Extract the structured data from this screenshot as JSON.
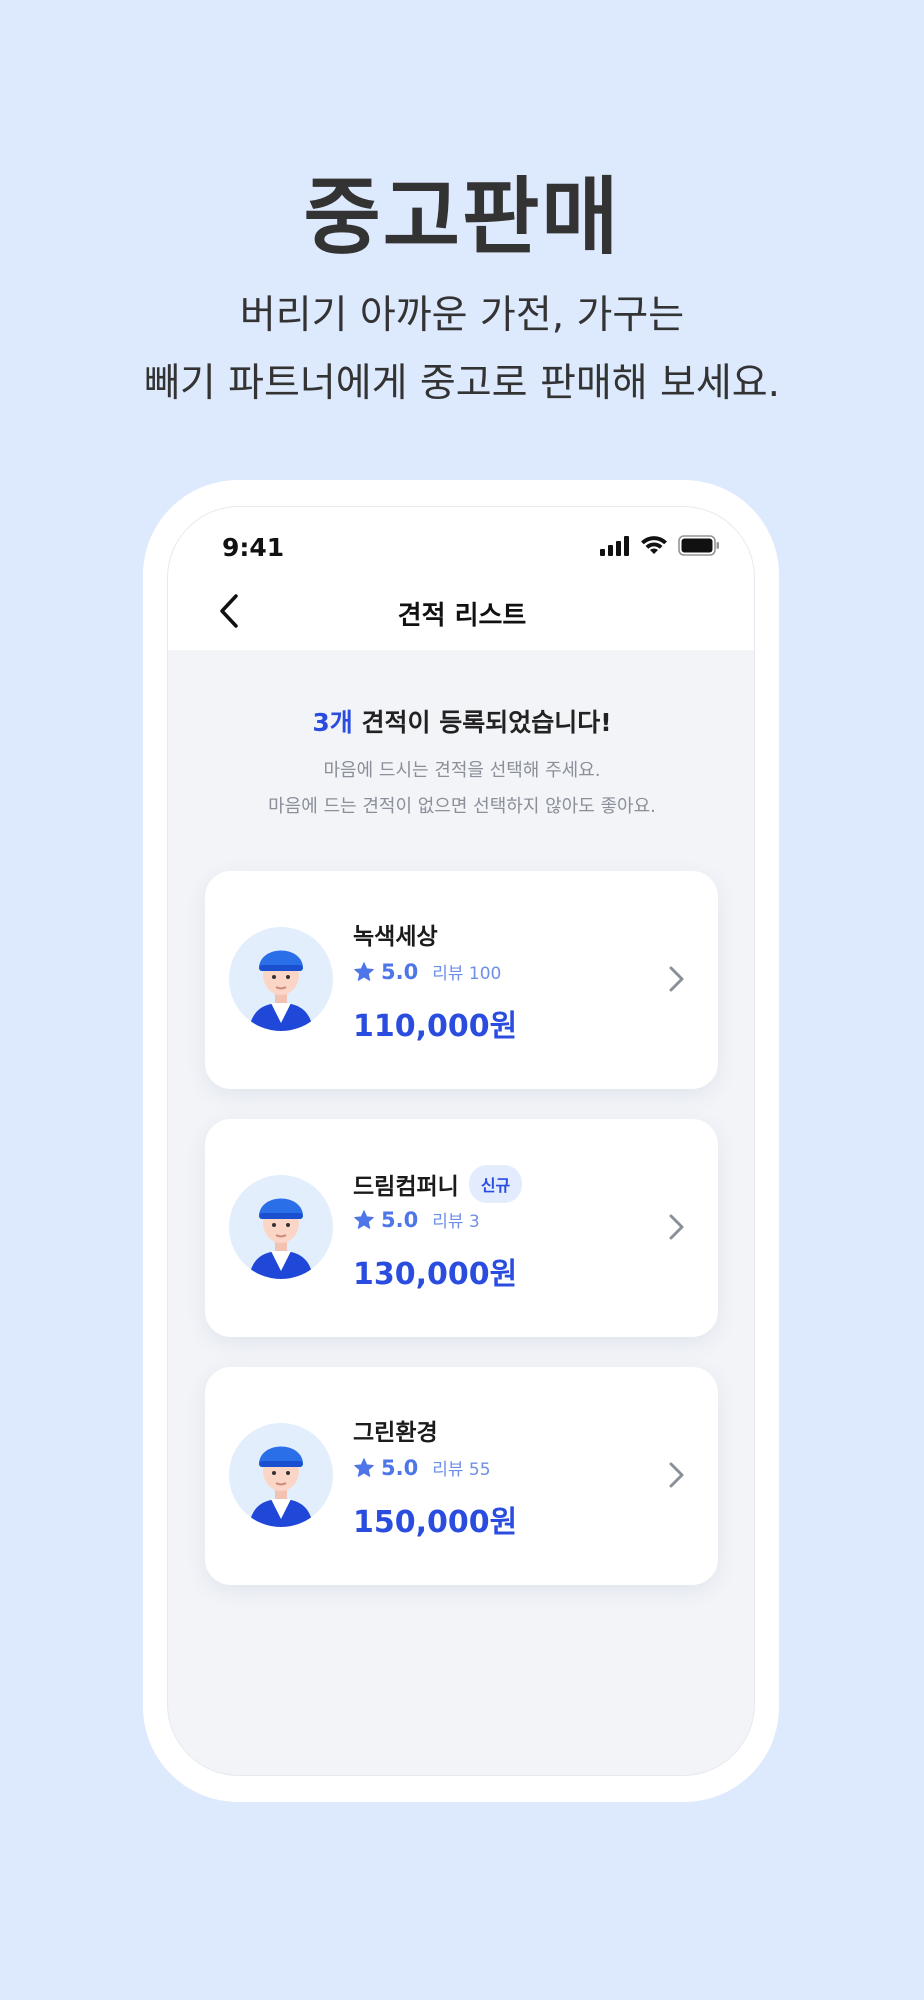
{
  "hero": {
    "title": "중고판매",
    "subtitle_line1": "버리기 아까운 가전, 가구는",
    "subtitle_line2": "빼기 파트너에게 중고로 판매해 보세요."
  },
  "status_bar": {
    "time": "9:41",
    "icons": [
      "signal-icon",
      "wifi-icon",
      "battery-icon"
    ]
  },
  "nav": {
    "title": "견적 리스트",
    "back_icon": "chevron-left-icon"
  },
  "summary": {
    "count": "3개",
    "headline_rest": " 견적이 등록되었습니다!",
    "desc_line1": "마음에 드시는 견적을 선택해 주세요.",
    "desc_line2": "마음에 드는 견적이 없으면 선택하지 않아도 좋아요."
  },
  "quotes": [
    {
      "name": "녹색세상",
      "badge": "",
      "rating": "5.0",
      "reviews": "리뷰 100",
      "price": "110,000원"
    },
    {
      "name": "드림컴퍼니",
      "badge": "신규",
      "rating": "5.0",
      "reviews": "리뷰 3",
      "price": "130,000원"
    },
    {
      "name": "그린환경",
      "badge": "",
      "rating": "5.0",
      "reviews": "리뷰 55",
      "price": "150,000원"
    }
  ],
  "colors": {
    "background": "#dde9fc",
    "accent": "#2a4de0",
    "rating": "#4f76e8",
    "badge_bg": "#e2ecfd"
  }
}
